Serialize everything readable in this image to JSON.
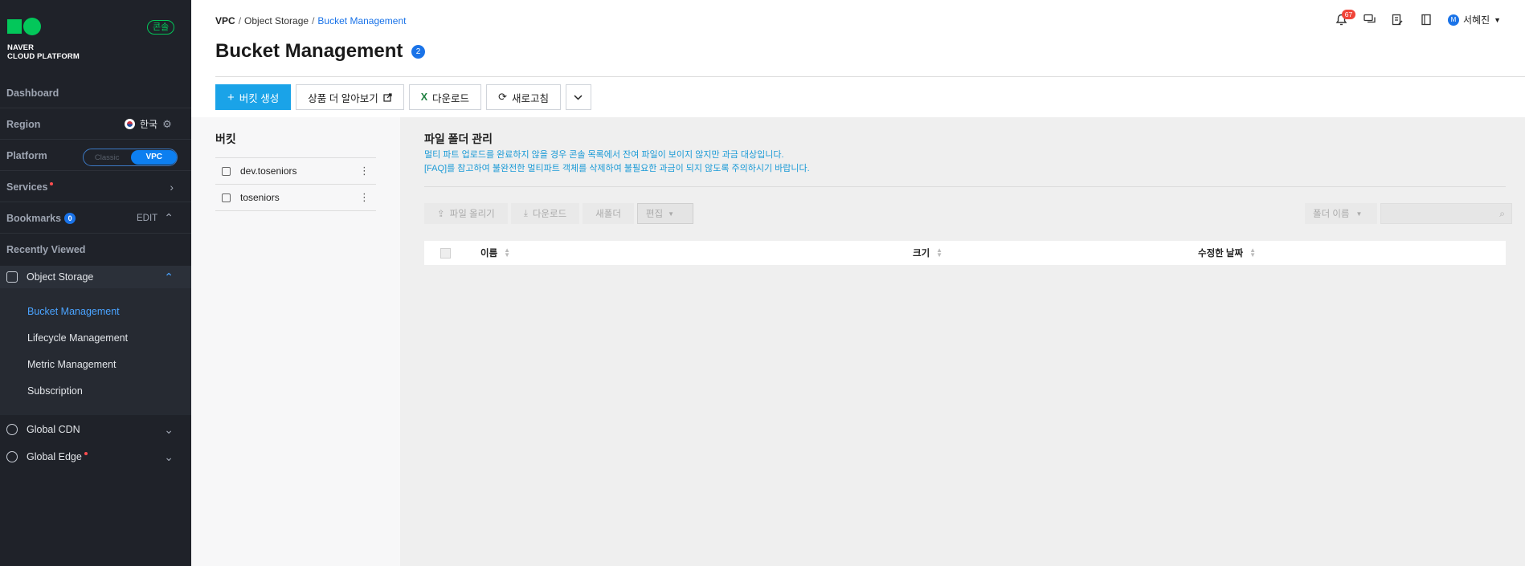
{
  "sidebar": {
    "logo_text_line1": "NAVER",
    "logo_text_line2": "CLOUD PLATFORM",
    "console_badge": "콘솔",
    "dashboard": "Dashboard",
    "region_label": "Region",
    "region_value": "한국",
    "platform_label": "Platform",
    "platform_classic": "Classic",
    "platform_vpc": "VPC",
    "services": "Services",
    "bookmarks": "Bookmarks",
    "bookmarks_count": "0",
    "bookmarks_edit": "EDIT",
    "recently_viewed": "Recently Viewed",
    "object_storage": "Object Storage",
    "sub_items": [
      "Bucket Management",
      "Lifecycle Management",
      "Metric Management",
      "Subscription"
    ],
    "global_cdn": "Global CDN",
    "global_edge": "Global Edge"
  },
  "header": {
    "breadcrumb": [
      "VPC",
      "Object Storage",
      "Bucket Management"
    ],
    "breadcrumb_sep": "/",
    "title": "Bucket Management",
    "title_badge": "2",
    "notifications_count": "67",
    "avatar_letter": "M",
    "user_name": "서혜진"
  },
  "toolbar": {
    "create_bucket": "버킷 생성",
    "learn_more": "상품 더 알아보기",
    "download": "다운로드",
    "refresh": "새로고침"
  },
  "bucket_panel": {
    "title": "버킷",
    "buckets": [
      "dev.toseniors",
      "toseniors"
    ]
  },
  "content": {
    "title": "파일 폴더 관리",
    "notice_1": "멀티 파트 업로드를 완료하지 않을 경우 콘솔 목록에서 잔여 파일이 보이지 않지만 과금 대상입니다.",
    "notice_2": "[FAQ]를 참고하여 불완전한 멀티파트 객체를 삭제하여 불필요한 과금이 되지 않도록 주의하시기 바랍니다.",
    "upload": "파일 올리기",
    "download": "다운로드",
    "new_folder": "새폴더",
    "edit": "편집",
    "search_select": "폴더 이름",
    "columns": [
      "이름",
      "크기",
      "수정한 날짜"
    ]
  }
}
